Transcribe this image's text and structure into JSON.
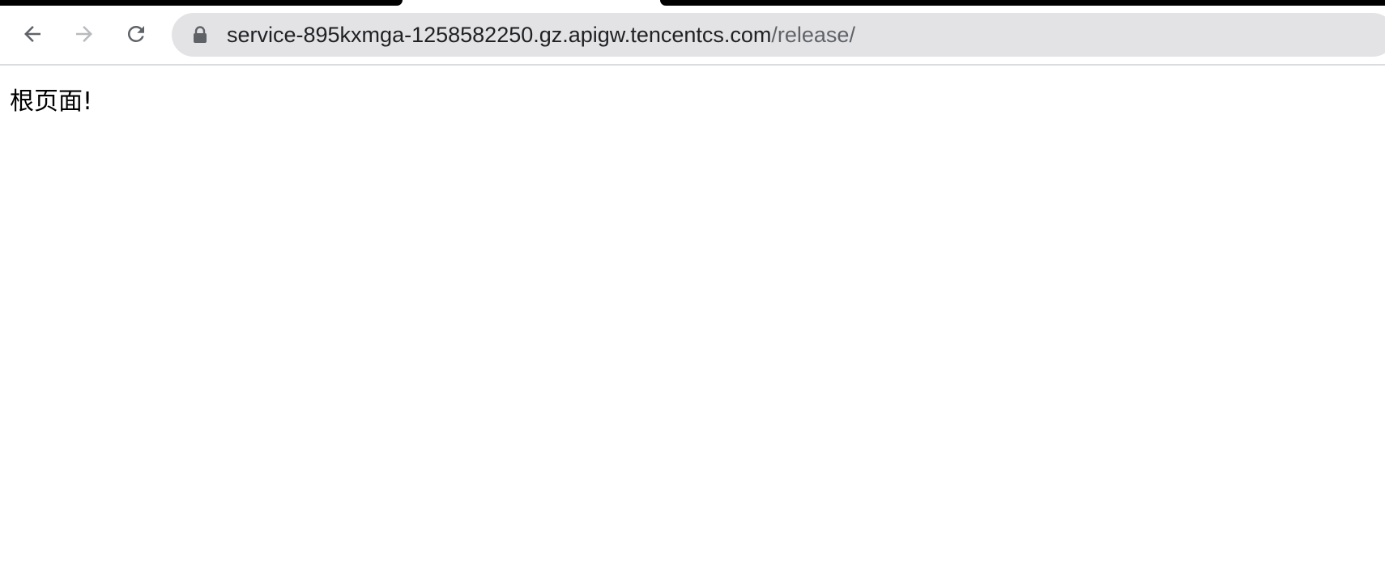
{
  "browser": {
    "url_host": "service-895kxmga-1258582250.gz.apigw.tencentcs.com",
    "url_path": "/release/",
    "icons": {
      "back": "back-arrow-icon",
      "forward": "forward-arrow-icon",
      "reload": "reload-icon",
      "lock": "lock-icon"
    }
  },
  "page": {
    "body_text": "根页面!"
  }
}
